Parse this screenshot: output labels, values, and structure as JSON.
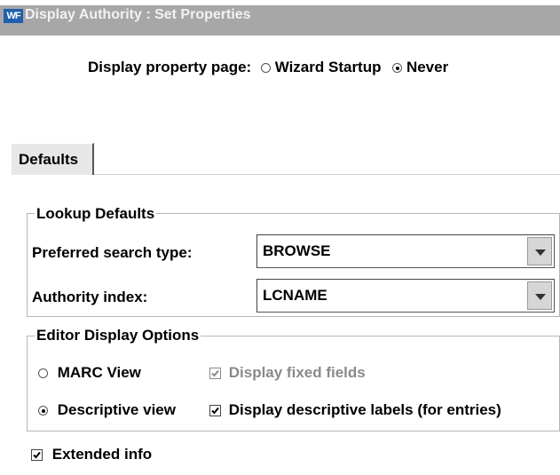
{
  "window": {
    "title": "Display Authority : Set Properties",
    "icon_text": "WF"
  },
  "property_page": {
    "label": "Display property page:",
    "options": [
      {
        "label": "Wizard Startup",
        "selected": false
      },
      {
        "label": "Never",
        "selected": true
      }
    ]
  },
  "tabs": [
    {
      "label": "Defaults",
      "active": true
    }
  ],
  "lookup_defaults": {
    "legend": "Lookup Defaults",
    "search_type_label": "Preferred search type:",
    "search_type_value": "BROWSE",
    "authority_index_label": "Authority index:",
    "authority_index_value": "LCNAME"
  },
  "editor_display": {
    "legend": "Editor Display Options",
    "marc_view_label": "MARC View",
    "marc_view_selected": false,
    "descriptive_view_label": "Descriptive view",
    "descriptive_view_selected": true,
    "fixed_fields_label": "Display fixed fields",
    "fixed_fields_checked": true,
    "fixed_fields_enabled": false,
    "descriptive_labels_label": "Display descriptive labels (for entries)",
    "descriptive_labels_checked": true
  },
  "extended_info": {
    "label": "Extended info",
    "checked": true
  }
}
